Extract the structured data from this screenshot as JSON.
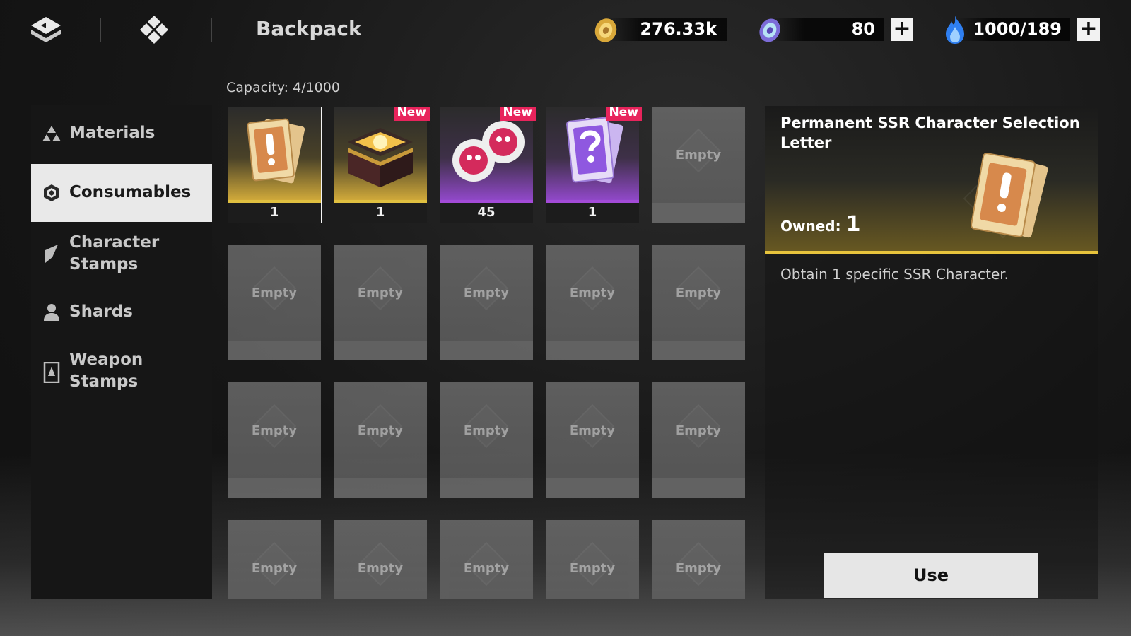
{
  "header": {
    "title": "Backpack",
    "currencies": [
      {
        "icon": "gold-coin-icon",
        "value": "276.33k",
        "has_plus": false
      },
      {
        "icon": "gem-orb-icon",
        "value": "80",
        "has_plus": true
      },
      {
        "icon": "blue-flame-icon",
        "value": "1000/189",
        "has_plus": true
      }
    ],
    "plus_label": "+"
  },
  "sidebar": {
    "items": [
      {
        "label": "Materials",
        "icon": "materials-icon",
        "active": false
      },
      {
        "label": "Consumables",
        "icon": "consumables-icon",
        "active": true
      },
      {
        "label": "Character Stamps",
        "icon": "character-stamps-icon",
        "active": false
      },
      {
        "label": "Shards",
        "icon": "shards-icon",
        "active": false
      },
      {
        "label": "Weapon Stamps",
        "icon": "weapon-stamps-icon",
        "active": false
      }
    ]
  },
  "inventory": {
    "capacity": "Capacity: 4/1000",
    "empty_label": "Empty",
    "new_label": "New",
    "items": [
      {
        "name": "ssr-selection-letter",
        "count": "1",
        "rarity_color": "#d9b93a",
        "new": false,
        "selected": true
      },
      {
        "name": "treasure-chest",
        "count": "1",
        "rarity_color": "#d9b93a",
        "new": true,
        "selected": false
      },
      {
        "name": "red-skull-orbs",
        "count": "45",
        "rarity_color": "#a34bd8",
        "new": true,
        "selected": false
      },
      {
        "name": "mystery-card",
        "count": "1",
        "rarity_color": "#a34bd8",
        "new": true,
        "selected": false
      }
    ]
  },
  "detail": {
    "name": "Permanent SSR Character Selection Letter",
    "owned_label": "Owned:",
    "owned_value": "1",
    "description": "Obtain 1 specific SSR Character.",
    "use_label": "Use"
  }
}
